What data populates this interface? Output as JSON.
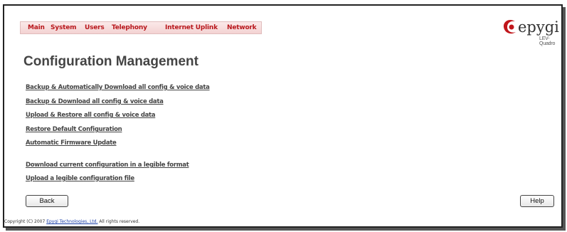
{
  "menu": {
    "items": [
      "Main",
      "System",
      "Users",
      "Telephony",
      "Internet Uplink",
      "Network"
    ]
  },
  "logo": {
    "name": "epygi",
    "model": "LEV-Quadro",
    "accent_color": "#c0161b"
  },
  "page": {
    "title": "Configuration Management"
  },
  "links": [
    "Backup & Automatically Download all config & voice data",
    "Backup & Download all config & voice data",
    "Upload & Restore all config & voice data",
    "Restore Default Configuration",
    "Automatic Firmware Update",
    "Download current configuration in a legible format",
    "Upload a legible configuration file"
  ],
  "buttons": {
    "back": "Back",
    "help": "Help"
  },
  "footer": {
    "prefix": "Copyright (C) 2007 ",
    "company": "Epygi Technologies, Ltd.",
    "suffix": " All rights reserved."
  }
}
